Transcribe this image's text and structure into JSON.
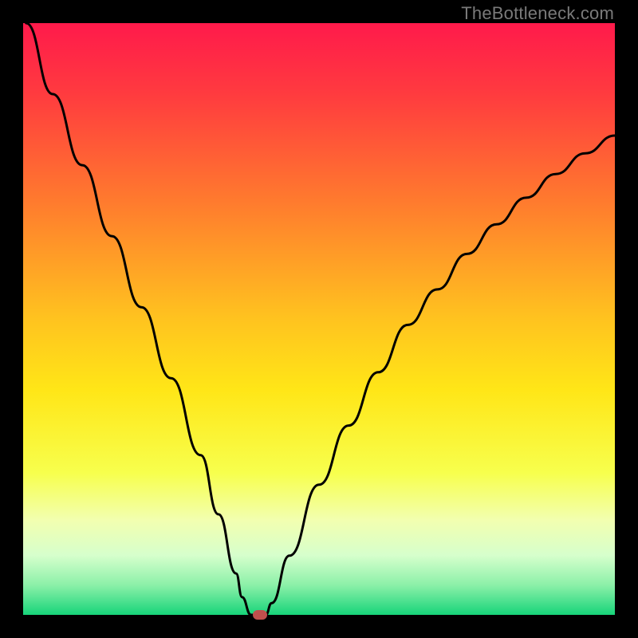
{
  "watermark": "TheBottleneck.com",
  "marker_color": "#c0504d",
  "gradient_stops": [
    {
      "offset": "0%",
      "color": "#ff1a4b"
    },
    {
      "offset": "12%",
      "color": "#ff3b3f"
    },
    {
      "offset": "30%",
      "color": "#ff7a2e"
    },
    {
      "offset": "50%",
      "color": "#ffc31f"
    },
    {
      "offset": "62%",
      "color": "#ffe617"
    },
    {
      "offset": "76%",
      "color": "#f7ff4d"
    },
    {
      "offset": "84%",
      "color": "#f2ffb0"
    },
    {
      "offset": "90%",
      "color": "#d6ffcc"
    },
    {
      "offset": "95%",
      "color": "#8bf0a8"
    },
    {
      "offset": "100%",
      "color": "#17d47a"
    }
  ],
  "chart_data": {
    "type": "line",
    "title": "",
    "xlabel": "",
    "ylabel": "",
    "xlim": [
      0,
      100
    ],
    "ylim": [
      0,
      100
    ],
    "grid": false,
    "legend": false,
    "series": [
      {
        "name": "curve",
        "x": [
          0.5,
          5,
          10,
          15,
          20,
          25,
          30,
          33,
          36,
          37,
          38.5,
          40,
          41,
          42,
          45,
          50,
          55,
          60,
          65,
          70,
          75,
          80,
          85,
          90,
          95,
          100
        ],
        "y": [
          100,
          88,
          76,
          64,
          52,
          40,
          27,
          17,
          7,
          3,
          0,
          0,
          0,
          2,
          10,
          22,
          32,
          41,
          49,
          55,
          61,
          66,
          70.5,
          74.5,
          78,
          81
        ]
      }
    ],
    "marker": {
      "x": 40,
      "y": 0
    }
  }
}
